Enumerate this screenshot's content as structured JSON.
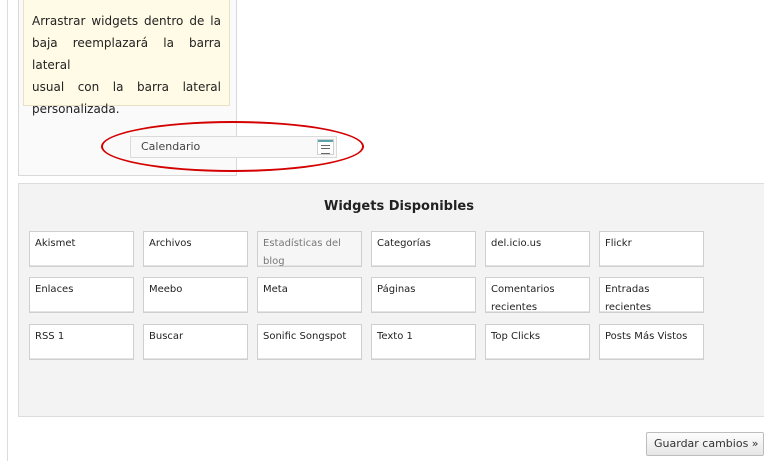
{
  "sidebar": {
    "hint_line_1": "Arrastrar widgets dentro de la",
    "hint_line_2": "baja reemplazará la barra lateral",
    "hint_line_3": "usual con la barra lateral",
    "hint_line_4": "personalizada.",
    "dropped_widget": {
      "label": "Calendario",
      "handle_icon": "menu-lines-icon"
    }
  },
  "highlight": {
    "color": "#d40000",
    "shape": "ellipse"
  },
  "available": {
    "title": "Widgets Disponibles",
    "widgets": [
      {
        "label": "Akismet",
        "disabled": false
      },
      {
        "label": "Archivos",
        "disabled": false
      },
      {
        "label": "Estadísticas del blog",
        "disabled": true
      },
      {
        "label": "Categorías",
        "disabled": false
      },
      {
        "label": "del.icio.us",
        "disabled": false
      },
      {
        "label": "Flickr",
        "disabled": false
      },
      {
        "label": "Enlaces",
        "disabled": false
      },
      {
        "label": "Meebo",
        "disabled": false
      },
      {
        "label": "Meta",
        "disabled": false
      },
      {
        "label": "Páginas",
        "disabled": false
      },
      {
        "label": "Comentarios recientes",
        "disabled": false
      },
      {
        "label": "Entradas recientes",
        "disabled": false
      },
      {
        "label": "RSS 1",
        "disabled": false
      },
      {
        "label": "Buscar",
        "disabled": false
      },
      {
        "label": "Sonific Songspot",
        "disabled": false
      },
      {
        "label": "Texto 1",
        "disabled": false
      },
      {
        "label": "Top Clicks",
        "disabled": false
      },
      {
        "label": "Posts Más Vistos",
        "disabled": false
      }
    ]
  },
  "save_button": {
    "label": "Guardar cambios »"
  }
}
